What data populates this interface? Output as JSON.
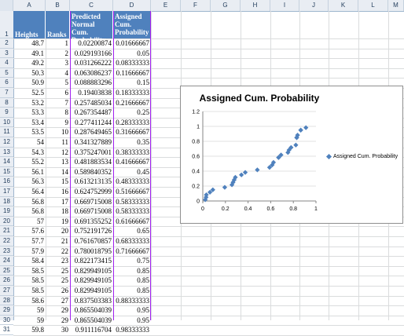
{
  "columns": [
    "A",
    "B",
    "C",
    "D",
    "E",
    "F",
    "G",
    "H",
    "I",
    "J",
    "K",
    "L",
    "M"
  ],
  "headers": {
    "heights": "Heights",
    "ranks": "Ranks",
    "predicted": "Predicted Normal Cum. Probability",
    "assigned": "Assigned Cum. Probability"
  },
  "rows": [
    [
      "48.7",
      "1",
      "0.02200874",
      "0.01666667"
    ],
    [
      "49.1",
      "2",
      "0.029193166",
      "0.05"
    ],
    [
      "49.2",
      "3",
      "0.031266222",
      "0.08333333"
    ],
    [
      "50.3",
      "4",
      "0.063086237",
      "0.11666667"
    ],
    [
      "50.9",
      "5",
      "0.088883296",
      "0.15"
    ],
    [
      "52.5",
      "6",
      "0.19403838",
      "0.18333333"
    ],
    [
      "53.2",
      "7",
      "0.257485034",
      "0.21666667"
    ],
    [
      "53.3",
      "8",
      "0.267354487",
      "0.25"
    ],
    [
      "53.4",
      "9",
      "0.277411244",
      "0.28333333"
    ],
    [
      "53.5",
      "10",
      "0.287649465",
      "0.31666667"
    ],
    [
      "54",
      "11",
      "0.341327889",
      "0.35"
    ],
    [
      "54.3",
      "12",
      "0.375247001",
      "0.38333333"
    ],
    [
      "55.2",
      "13",
      "0.481883534",
      "0.41666667"
    ],
    [
      "56.1",
      "14",
      "0.589840352",
      "0.45"
    ],
    [
      "56.3",
      "15",
      "0.613213135",
      "0.48333333"
    ],
    [
      "56.4",
      "16",
      "0.624752999",
      "0.51666667"
    ],
    [
      "56.8",
      "17",
      "0.669715008",
      "0.58333333"
    ],
    [
      "56.8",
      "18",
      "0.669715008",
      "0.58333333"
    ],
    [
      "57",
      "19",
      "0.691355252",
      "0.61666667"
    ],
    [
      "57.6",
      "20",
      "0.752191726",
      "0.65"
    ],
    [
      "57.7",
      "21",
      "0.761670857",
      "0.68333333"
    ],
    [
      "57.9",
      "22",
      "0.780018795",
      "0.71666667"
    ],
    [
      "58.4",
      "23",
      "0.822173415",
      "0.75"
    ],
    [
      "58.5",
      "25",
      "0.829949105",
      "0.85"
    ],
    [
      "58.5",
      "25",
      "0.829949105",
      "0.85"
    ],
    [
      "58.5",
      "26",
      "0.829949105",
      "0.85"
    ],
    [
      "58.6",
      "27",
      "0.837503383",
      "0.88333333"
    ],
    [
      "59",
      "29",
      "0.865504039",
      "0.95"
    ],
    [
      "59",
      "29",
      "0.865504039",
      "0.95"
    ],
    [
      "59.8",
      "30",
      "0.911116704",
      "0.98333333"
    ]
  ],
  "chart_data": {
    "type": "scatter",
    "title": "Assigned Cum. Probability",
    "series": [
      {
        "name": "Assigned Cum. Probability",
        "x": [
          0.02200874,
          0.029193166,
          0.031266222,
          0.063086237,
          0.088883296,
          0.19403838,
          0.257485034,
          0.267354487,
          0.277411244,
          0.287649465,
          0.341327889,
          0.375247001,
          0.481883534,
          0.589840352,
          0.613213135,
          0.624752999,
          0.669715008,
          0.669715008,
          0.691355252,
          0.752191726,
          0.761670857,
          0.780018795,
          0.822173415,
          0.829949105,
          0.829949105,
          0.829949105,
          0.837503383,
          0.865504039,
          0.865504039,
          0.911116704
        ],
        "y": [
          0.01666667,
          0.05,
          0.08333333,
          0.11666667,
          0.15,
          0.18333333,
          0.21666667,
          0.25,
          0.28333333,
          0.31666667,
          0.35,
          0.38333333,
          0.41666667,
          0.45,
          0.48333333,
          0.51666667,
          0.58333333,
          0.58333333,
          0.61666667,
          0.65,
          0.68333333,
          0.71666667,
          0.75,
          0.85,
          0.85,
          0.85,
          0.88333333,
          0.95,
          0.95,
          0.98333333
        ]
      }
    ],
    "xlim": [
      0,
      1
    ],
    "ylim": [
      0,
      1.2
    ],
    "xticks": [
      "0",
      "0.2",
      "0.4",
      "0.6",
      "0.8",
      "1"
    ],
    "yticks": [
      "0",
      "0.2",
      "0.4",
      "0.6",
      "0.8",
      "1",
      "1.2"
    ],
    "marker_color": "#4f81bd",
    "legend": "right"
  }
}
